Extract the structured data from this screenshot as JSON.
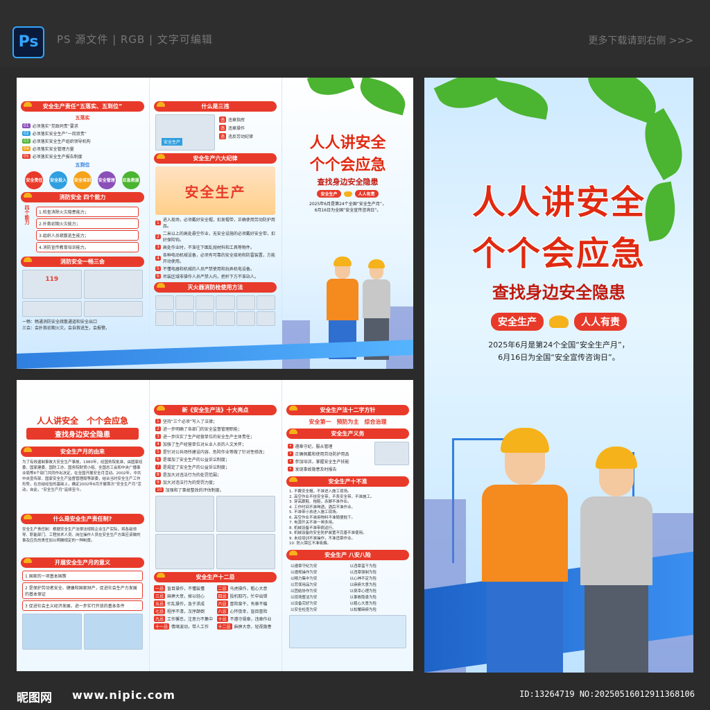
{
  "header": {
    "ps_badge": "Ps",
    "left_text": "PS 源文件 | RGB | 文字可编辑",
    "right_text": "更多下载请到右侧 >>>"
  },
  "top_brochure": {
    "left_col": {
      "sec1_title": "安全生产责任“五落实、五到位”",
      "sec1_sub": "五落实",
      "five_items": [
        "必须落实“党政同责”要求",
        "必须落实安全生产“一岗双责”",
        "必须落实安全生产组织领导机构",
        "必须落实安全管理力量",
        "必须落实安全生产报告制度"
      ],
      "sec2_sub": "五到位",
      "circles": [
        "安全责任",
        "安全投入",
        "安全培训",
        "安全管理",
        "应急救援"
      ],
      "sec3_title": "消防安全 四个能力",
      "four_label": "四个能力",
      "four_items": [
        "1.检查消除火灾隐患能力；",
        "2.扑救初期火灾能力；",
        "3.组织人员疏散逃生能力；",
        "4.消防宣传教育培训能力。"
      ],
      "sec4_title": "消防安全一畅三会",
      "fire_num": "119",
      "footnote": [
        "一畅：畅通消防安全疏散通道和安全出口",
        "三会：会扑救初期火灾，会自救逃生，会报警。"
      ]
    },
    "mid_col": {
      "sec1_title": "什么是三违",
      "sign_text": "安全生产",
      "three_items": [
        "违章指挥",
        "违章操作",
        "违反劳动纪律"
      ],
      "sec2_title": "安全生产六大纪律",
      "banner_text": "安全生产",
      "six_items": [
        "进入现场，必须戴好安全帽，扣发帽带，正确使用劳动防护用品。",
        "二米以上的高处悬空作业，无安全设施的必须戴好安全带，扣好保险钩。",
        "高处作业时，不准往下面乱抛材料和工具等物件。",
        "各种电动机械设备，必须有可靠的安全接地和防雷装置，方能开动使用。",
        "不懂电器和机械的人员严禁使用和玩弄机电设备。",
        "吊装区域非操作人员严禁入内，把杆下方不准站人。"
      ],
      "sec3_title": "灭火器消防栓使用方法"
    },
    "right_col": {
      "title1": "人人讲安全",
      "title2": "个个会应急",
      "subtitle": "查找身边安全隐患",
      "pill_left": "安全生产",
      "pill_right": "人人有责",
      "date_line1": "2025年6月是第24个全国“安全生产月”，",
      "date_line2": "6月16日为全国“安全宣传咨询日”。"
    }
  },
  "bottom_brochure": {
    "left_col": {
      "title1": "人人讲安全　个个会应急",
      "subtitle": "查找身边安全隐患",
      "sec1_title": "安全生产月的由来",
      "origin_text": "为了有效遏制事故大安全生产事故，1980年，经国务院批准，由国家经委、国家建委、国防工办、国务院财贸小组、全国总工会和中央广播事业局等6个部门共同作出决定，在全国开展安全月活动。2002年，中共中央宣传部、国家安全生产监督管理局等部委，结合当时安全生产工作形势，在总结经验的基础上，确定2002年6月开展首次“安全生产月”活动，自此，“安全生产月”延续至今。",
      "sec2_title": "什么是安全生产责任制?",
      "resp_text": "安全生产责任制：根据安全生产法律法规和企业生产实际，将各级领导、职能部门、工程技术人员、岗位操作人员在安全生产方面应该做的事及应负的责任加以明确规定的一种制度。",
      "sec3_title": "开展安全生产月的意义",
      "meaning_items": [
        "1 国家的一项基本国策",
        "2 是保护劳动者安全、健康和国家财产，促进社会生产力发展的基本保证",
        "3 促进社会主义经济发展，进一步实行开放的基本条件"
      ]
    },
    "mid_col": {
      "sec1_title": "新《安全生产法》十大亮点",
      "ten_items": [
        "坚持“三个必须”写入了法律；",
        "进一步明确了各部门的安全监督管理职能；",
        "进一步压实了生产经营单位的安全生产主体责任；",
        "加强了生产经营单位对从业人员的人文关怀；",
        "是针对公共场所建设内容、危险作业等做了针对性修改；",
        "是增加了安全生产的公益诉讼制度；",
        "是规定了安全生产的公益诉讼制度；",
        "是加大对违法行为的处罚范围；",
        "加大对违法行为的受罚力度；",
        "加强和了事故整改的评估制度。"
      ],
      "sec2_title": "安全生产十二忌",
      "twelve_tags": [
        "一忌",
        "二忌",
        "三忌",
        "四忌",
        "五忌",
        "六忌",
        "七忌",
        "八忌",
        "九忌",
        "十忌",
        "十一忌",
        "十二忌"
      ],
      "twelve_items": [
        "盲目操作，不懂装懂",
        "马虎操作，粗心大意",
        "麻痹大意，掉以轻心",
        "投机取巧，忙中出错",
        "忙乱操作，急于求成",
        "冒险蛮干，有章不循",
        "程序不清，次序颠倒",
        "心怀侥幸，盲目冒险",
        "工作懈怠，注意力不集中",
        "不遵守规章，违章作业",
        "情绪波动，带人工作",
        "麻痹大意，轻视隐患"
      ]
    },
    "right_col": {
      "sec1_title": "安全生产法十二字方针",
      "motto": "安全第一　预防为主　综合治理",
      "sec2_title": "安全生产义务",
      "duty_items": [
        "遵章守纪，服从管理",
        "正确佩戴和使用劳动防护用品",
        "参加培训，掌握安全生产技能",
        "发现事故隐患及时报告"
      ],
      "sec3_title": "安全生产十不准",
      "ten_nots": [
        "1. 不戴安全帽，不准进入施工现场。",
        "2. 高空作业不挂安全带，不系安全带，不准施工。",
        "3. 穿高跟鞋、拖鞋，赤脚不准作业。",
        "4. 工作时间不准喝酒，酒后不准作业。",
        "5. 不准带小孩进入施工现场。",
        "6. 高空作业不准用物料不准随便抛下。",
        "7. 电源开关不准一闸多用。",
        "8. 机械设备不准带病运行。",
        "9. 机械设备的安全防护装置不完善不准使用。",
        "9. 未经培训不准操作，不准违章作业。",
        "10. 防火禁区不准吸烟。"
      ],
      "sec4_title": "安全生产 八安八险",
      "eight_safe": [
        "以遵章守纪为安",
        "以遵规操作为安",
        "以精力集中为安",
        "以劳保用品为安",
        "以团结协作为安",
        "以现场整洁为安",
        "以设备完好为安",
        "以安全检查为安"
      ],
      "eight_risk": [
        "以违章蛮干为险",
        "以违章强制为险",
        "以心神不定为险",
        "以麻痹大意为险",
        "以侥幸心理为险",
        "以事故隐患为险",
        "以粗心大意为险",
        "以松懈麻痹为险"
      ]
    }
  },
  "poster": {
    "title1": "人人讲安全",
    "title2": "个个会应急",
    "subtitle": "查找身边安全隐患",
    "pill_left": "安全生产",
    "pill_right": "人人有责",
    "date_line1": "2025年6月是第24个全国“安全生产月”，",
    "date_line2": "6月16日为全国“安全宣传咨询日”。"
  },
  "footer": {
    "logo": "昵图网",
    "url": "www.nipic.com",
    "id_text": "ID:13264719 NO:20250516012911368106"
  },
  "colors": {
    "red": "#e83a2a",
    "yellow": "#f6b21a",
    "blue": "#2f7fe0",
    "green": "#4bb431"
  }
}
